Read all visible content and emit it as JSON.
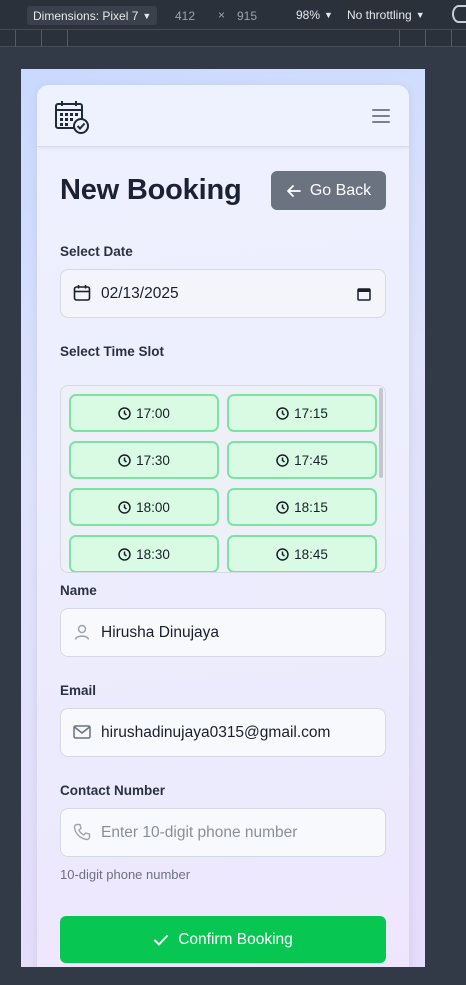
{
  "devtools": {
    "dimensions_label": "Dimensions: Pixel 7",
    "width": "412",
    "times": "×",
    "height": "915",
    "zoom": "98%",
    "throttling": "No throttling"
  },
  "header": {
    "logo_icon": "calendar-check-icon",
    "menu_icon": "hamburger-menu-icon"
  },
  "page": {
    "title": "New Booking",
    "go_back_label": "Go Back"
  },
  "date": {
    "label": "Select Date",
    "value": "02/13/2025"
  },
  "time_slot": {
    "label": "Select Time Slot",
    "slots": [
      "17:00",
      "17:15",
      "17:30",
      "17:45",
      "18:00",
      "18:15",
      "18:30",
      "18:45"
    ]
  },
  "name": {
    "label": "Name",
    "value": "Hirusha Dinujaya"
  },
  "email": {
    "label": "Email",
    "value": "hirushadinujaya0315@gmail.com"
  },
  "contact": {
    "label": "Contact Number",
    "placeholder": "Enter 10-digit phone number",
    "hint": "10-digit phone number"
  },
  "confirm_label": "Confirm Booking",
  "colors": {
    "primary_green": "#07c752",
    "slot_bg": "#d9fbe4",
    "slot_border": "#7ee2a4",
    "back_button": "#6b7280"
  }
}
